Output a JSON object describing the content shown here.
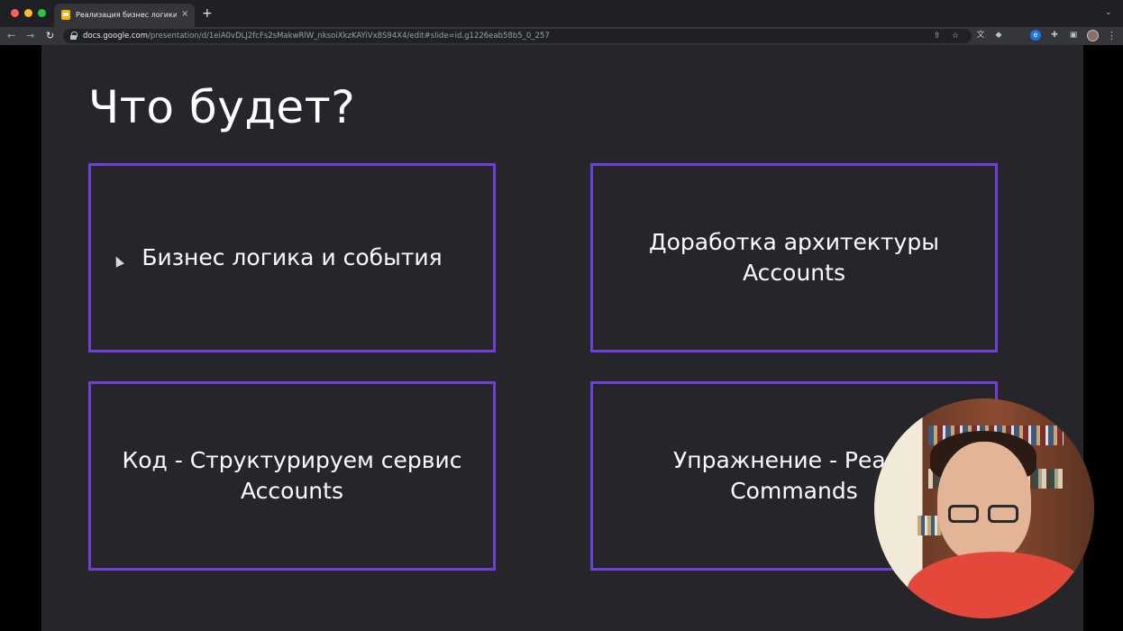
{
  "browser": {
    "tab_title": "Реализация бизнес логики -",
    "tab_close": "×",
    "new_tab": "+",
    "url_host": "docs.google.com",
    "url_path": "/presentation/d/1eiA0vDLJ2fcFs2sMakwRlW_nksoiXkzKAYiVx8S94X4/edit#slide=id.g1226eab58b5_0_257"
  },
  "slide": {
    "title": "Что будет?",
    "boxes": [
      {
        "text": "Бизнес логика и события"
      },
      {
        "text": "Доработка архитектуры\nAccounts"
      },
      {
        "text": "Код - Структурируем сервис\nAccounts"
      },
      {
        "text": "Упражнение - Реали\nCommands"
      }
    ]
  },
  "colors": {
    "slide_background": "#262529",
    "box_border": "#6f3fd6",
    "text": "#ffffff"
  },
  "icons": [
    "back-arrow-icon",
    "forward-arrow-icon",
    "reload-icon",
    "lock-icon",
    "share-icon",
    "star-icon",
    "translate-icon",
    "extensions-icon",
    "side-panel-icon",
    "more-menu-icon"
  ]
}
